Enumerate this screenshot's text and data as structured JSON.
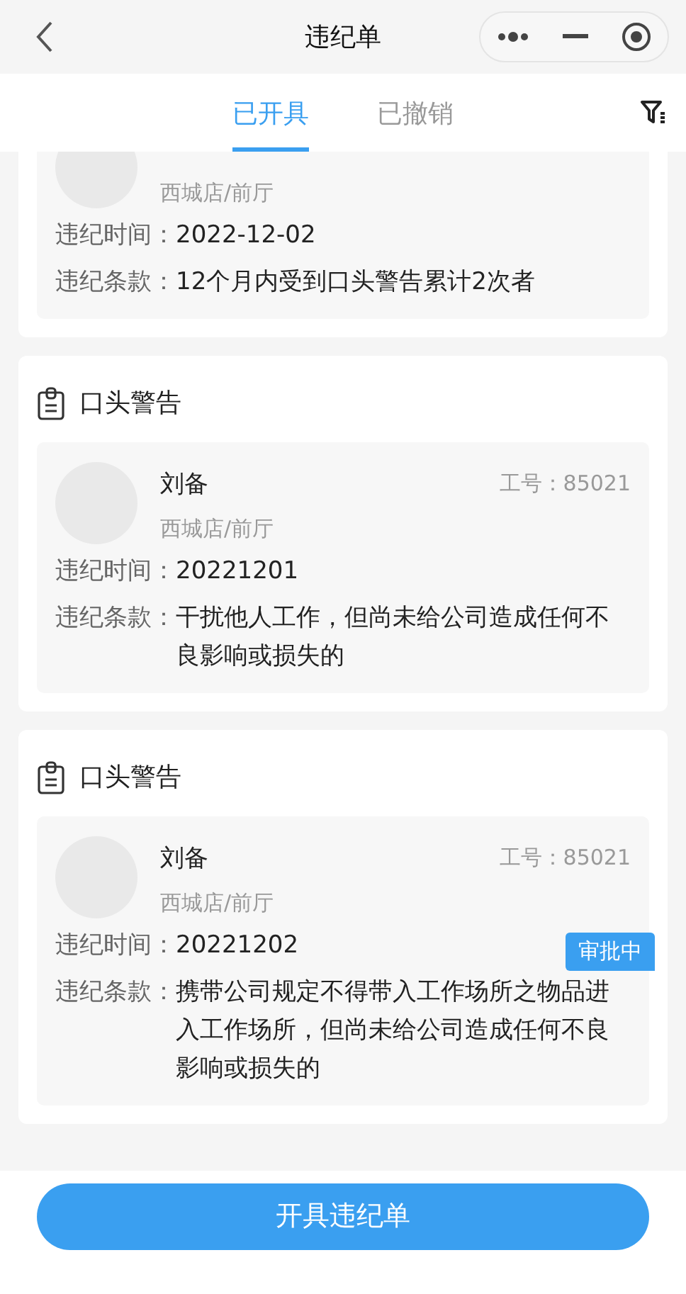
{
  "window": {
    "title": "违纪单"
  },
  "tabs": [
    {
      "label": "已开具",
      "selected": true
    },
    {
      "label": "已撤销",
      "selected": false
    }
  ],
  "records": [
    {
      "department": "西城店/前厅",
      "time_label": "违纪时间：",
      "time": "2022-12-02",
      "clause_label": "违纪条款：",
      "clause": "12个月内受到口头警告累计2次者"
    },
    {
      "title": "口头警告",
      "name": "刘备",
      "employee_id": "工号：85021",
      "department": "西城店/前厅",
      "time_label": "违纪时间：",
      "time": "20221201",
      "clause_label": "违纪条款：",
      "clause": "干扰他人工作，但尚未给公司造成任何不良影响或损失的"
    },
    {
      "title": "口头警告",
      "name": "刘备",
      "employee_id": "工号：85021",
      "department": "西城店/前厅",
      "time_label": "违纪时间：",
      "time": "20221202",
      "clause_label": "违纪条款：",
      "clause": "携带公司规定不得带入工作场所之物品进入工作场所，但尚未给公司造成任何不良影响或损失的",
      "status": "审批中"
    }
  ],
  "primary_button": "开具违纪单"
}
